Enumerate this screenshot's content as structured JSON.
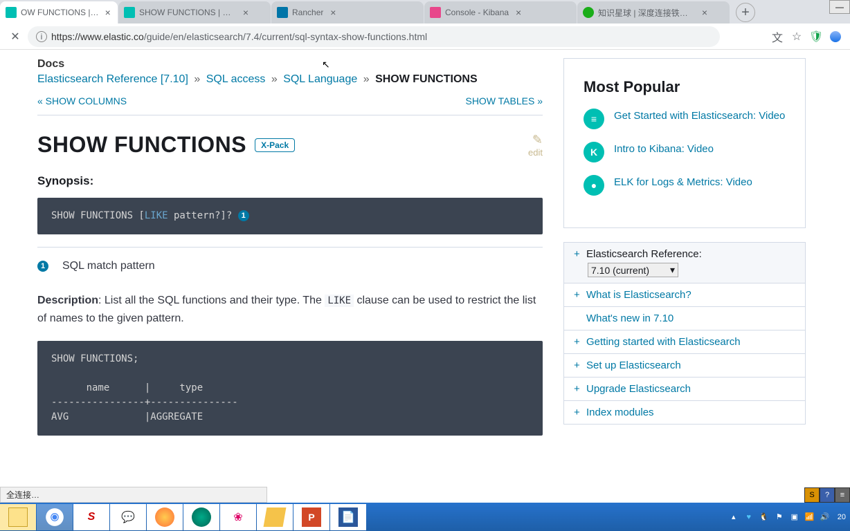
{
  "tabs": [
    {
      "title": "OW FUNCTIONS | Elastics",
      "icon_color": "#00bfb3"
    },
    {
      "title": "SHOW FUNCTIONS | Elastics",
      "icon_color": "#00bfb3"
    },
    {
      "title": "Rancher",
      "icon_color": "#0075a8"
    },
    {
      "title": "Console - Kibana",
      "icon_color": "#e8478b"
    },
    {
      "title": "知识星球 | 深度连接铁杆粉丝",
      "icon_color": "#1aad19"
    }
  ],
  "url": {
    "host": "https://www.elastic.co",
    "path": "/guide/en/elasticsearch/7.4/current/sql-syntax-show-functions.html"
  },
  "breadcrumb": {
    "docs": "Docs",
    "items": [
      "Elasticsearch Reference [7.10]",
      "SQL access",
      "SQL Language"
    ],
    "current": "SHOW FUNCTIONS"
  },
  "pager": {
    "prev": "« SHOW COLUMNS",
    "next": "SHOW TABLES »"
  },
  "page": {
    "title": "SHOW FUNCTIONS",
    "badge": "X-Pack",
    "edit": "edit",
    "synopsis": "Synopsis:",
    "code1_prefix": "SHOW FUNCTIONS [",
    "code1_kw": "LIKE",
    "code1_suffix": " pattern?]? ",
    "note": "SQL match pattern",
    "desc_label": "Description",
    "desc_text_a": ": List all the SQL functions and their type. The ",
    "desc_code": "LIKE",
    "desc_text_b": " clause can be used to restrict the list of names to the given pattern.",
    "code2": "SHOW FUNCTIONS;\n\n      name      |     type\n----------------+---------------\nAVG             |AGGREGATE"
  },
  "sidebar": {
    "popular_title": "Most Popular",
    "items": [
      {
        "label": "Get Started with Elasticsearch: Video",
        "icon": "≡"
      },
      {
        "label": "Intro to Kibana: Video",
        "icon": "K"
      },
      {
        "label": "ELK for Logs & Metrics: Video",
        "icon": "●"
      }
    ],
    "ref_label": "Elasticsearch Reference:",
    "version": "7.10 (current)",
    "nav": [
      {
        "label": "What is Elasticsearch?",
        "expandable": true
      },
      {
        "label": "What's new in 7.10",
        "sub": true
      },
      {
        "label": "Getting started with Elasticsearch",
        "expandable": true
      },
      {
        "label": "Set up Elasticsearch",
        "expandable": true
      },
      {
        "label": "Upgrade Elasticsearch",
        "expandable": true
      },
      {
        "label": "Index modules",
        "expandable": true
      }
    ]
  },
  "status": "全连接…",
  "time_partial": "20"
}
